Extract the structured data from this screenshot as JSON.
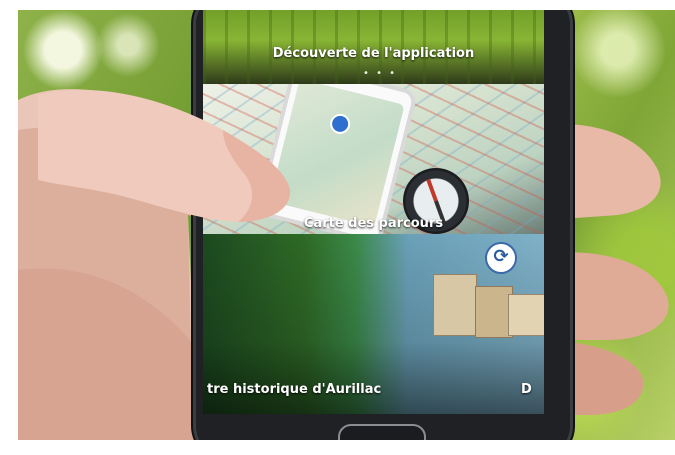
{
  "scene": "hand holding smartphone with tourism app",
  "app": {
    "cards": [
      {
        "title": "Découverte de l'application",
        "dots": "• • •"
      },
      {
        "title": "Carte des parcours"
      },
      {
        "title": "tre historique d'Aurillac",
        "edge_text": "D"
      }
    ],
    "refresh_icon_glyph": "⟳"
  },
  "colors": {
    "background_green": "#7fa636",
    "phone_body": "#1f2124",
    "card_title_text": "#ffffff"
  }
}
